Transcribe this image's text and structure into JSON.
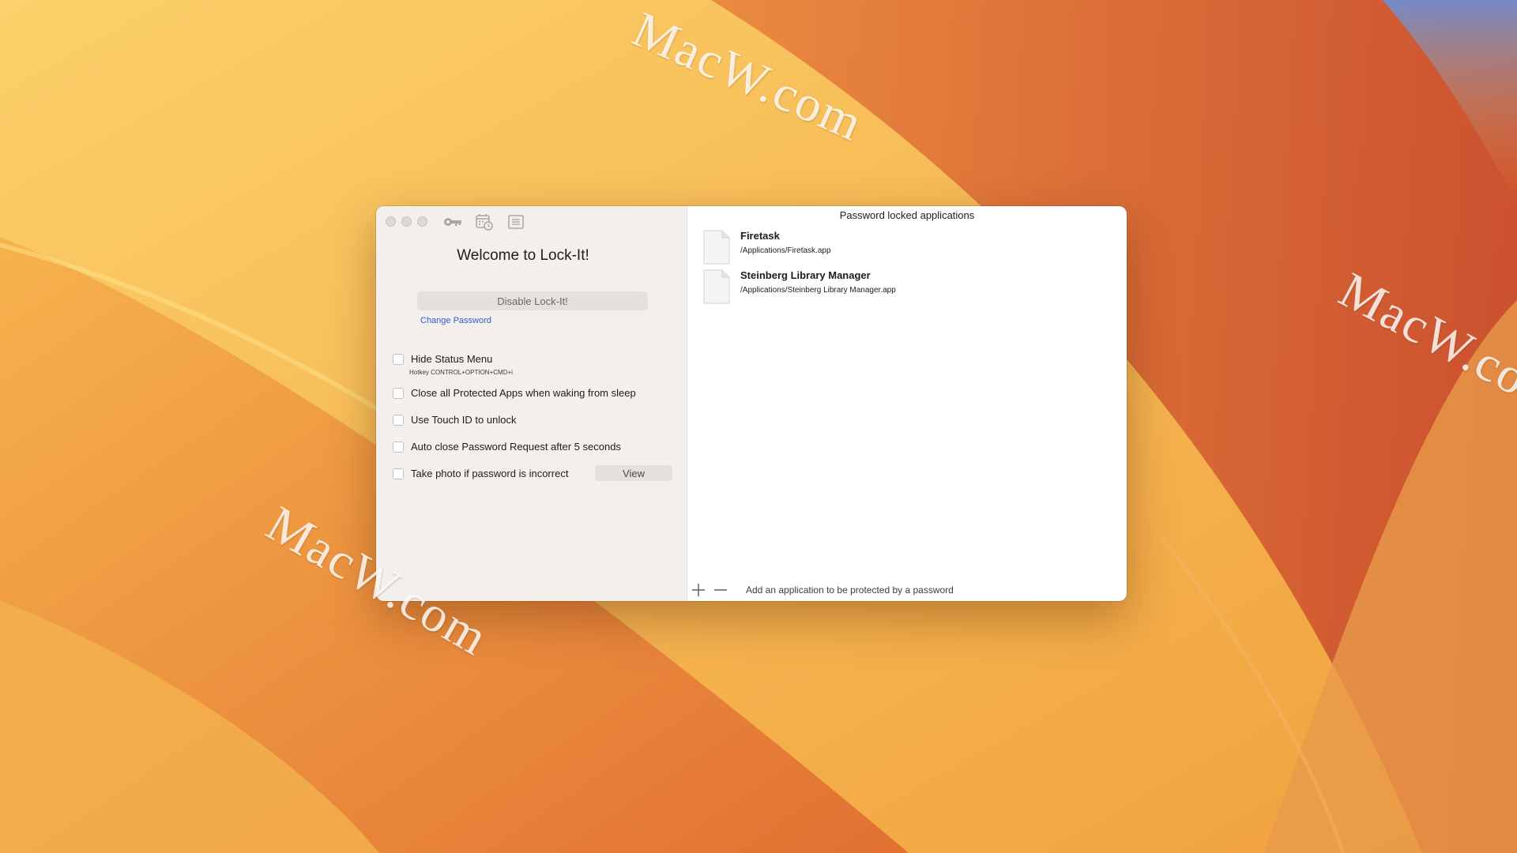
{
  "watermark": "MacW.com",
  "window": {
    "toolbar": {
      "icons": [
        "key-icon",
        "calendar-clock-icon",
        "list-icon"
      ]
    },
    "left": {
      "welcome_title": "Welcome to Lock-It!",
      "disable_label": "Disable Lock-It!",
      "change_password_label": "Change Password",
      "options": {
        "hide_status_menu": {
          "label": "Hide Status Menu",
          "checked": false
        },
        "hotkey_hint": "Hotkey CONTROL+OPTION+CMD+i",
        "close_on_wake": {
          "label": "Close all Protected Apps when waking from sleep",
          "checked": false
        },
        "touch_id": {
          "label": "Use Touch ID to unlock",
          "checked": false
        },
        "auto_close": {
          "label": "Auto close Password Request after 5 seconds",
          "checked": false
        },
        "take_photo": {
          "label": "Take photo if password is incorrect",
          "checked": false
        }
      },
      "view_label": "View"
    },
    "right": {
      "header": "Password locked applications",
      "apps": [
        {
          "name": "Firetask",
          "path": "/Applications/Firetask.app"
        },
        {
          "name": "Steinberg Library Manager",
          "path": "/Applications/Steinberg Library Manager.app"
        }
      ],
      "bottom_hint": "Add an application to be protected by a password"
    }
  },
  "colors": {
    "link": "#2b5ec6",
    "sidebar_bg": "#f3efec",
    "button_bg": "#e4e0dd"
  }
}
